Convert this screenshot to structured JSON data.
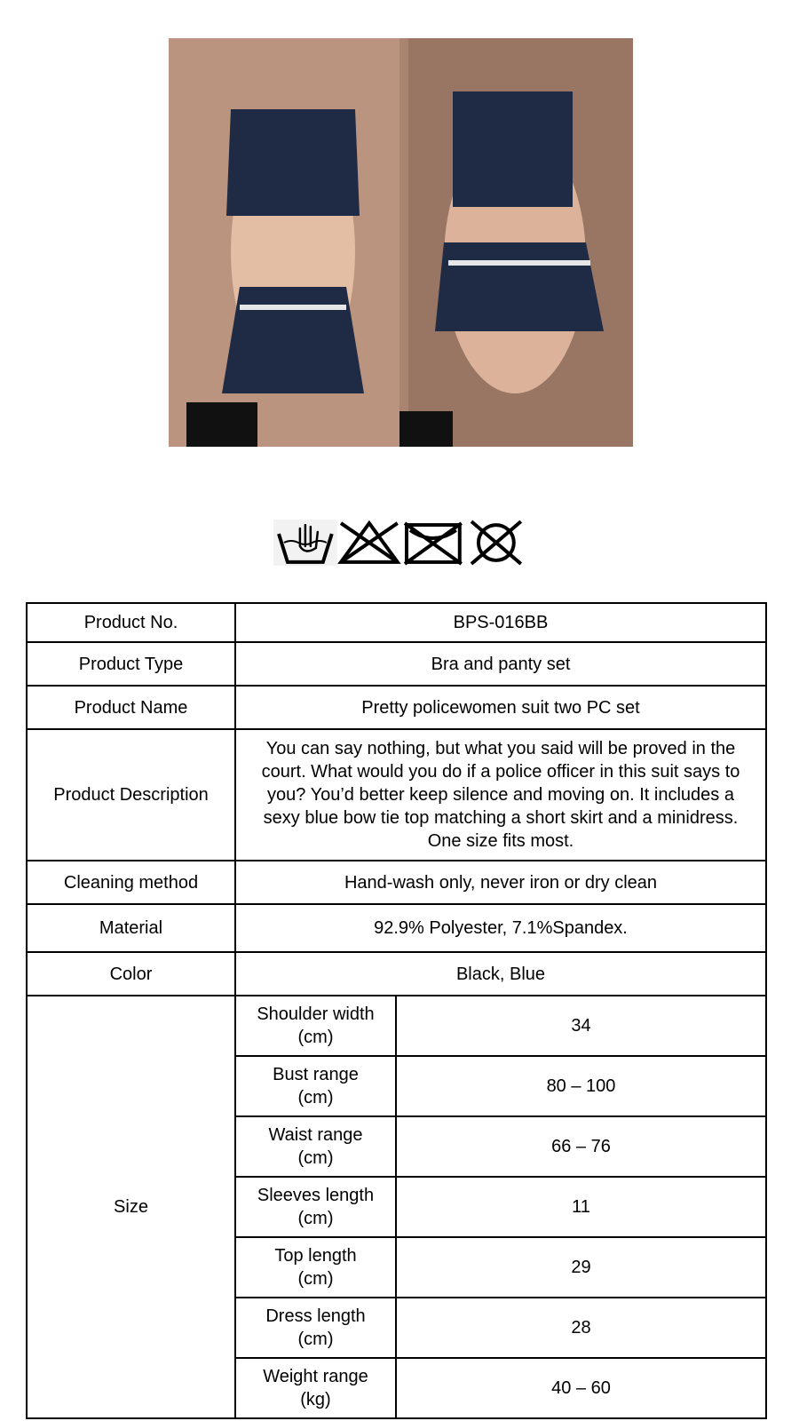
{
  "photo": {
    "alt": "Product photo"
  },
  "care_icons": [
    {
      "icon": "hand-wash-icon"
    },
    {
      "icon": "no-bleach-icon"
    },
    {
      "icon": "no-tumble-dry-icon"
    },
    {
      "icon": "no-dry-clean-icon"
    }
  ],
  "specs": {
    "product_no": {
      "label": "Product No.",
      "value": "BPS-016BB"
    },
    "product_type": {
      "label": "Product Type",
      "value": "Bra and panty set"
    },
    "product_name": {
      "label": "Product Name",
      "value": "Pretty policewomen suit two PC set"
    },
    "product_description": {
      "label": "Product Description",
      "value": "You can say nothing, but what you said will be proved in the court. What would you do if a police officer in this suit says to you? You’d better keep silence and moving on. It includes a sexy blue bow tie top matching a short skirt and a minidress. One size fits most."
    },
    "cleaning_method": {
      "label": "Cleaning method",
      "value": "Hand-wash only, never iron or dry clean"
    },
    "material": {
      "label": "Material",
      "value": "92.9% Polyester, 7.1%Spandex."
    },
    "color": {
      "label": "Color",
      "value": "Black, Blue"
    },
    "size": {
      "label": "Size",
      "rows": [
        {
          "name": "Shoulder width",
          "unit": "(cm)",
          "value": "34"
        },
        {
          "name": "Bust range",
          "unit": "(cm)",
          "value": "80 – 100"
        },
        {
          "name": "Waist range",
          "unit": "(cm)",
          "value": "66 – 76"
        },
        {
          "name": "Sleeves length",
          "unit": "(cm)",
          "value": "11"
        },
        {
          "name": "Top length",
          "unit": "(cm)",
          "value": "29"
        },
        {
          "name": "Dress length",
          "unit": "(cm)",
          "value": "28"
        },
        {
          "name": "Weight range",
          "unit": "(kg)",
          "value": "40 – 60"
        }
      ]
    }
  }
}
